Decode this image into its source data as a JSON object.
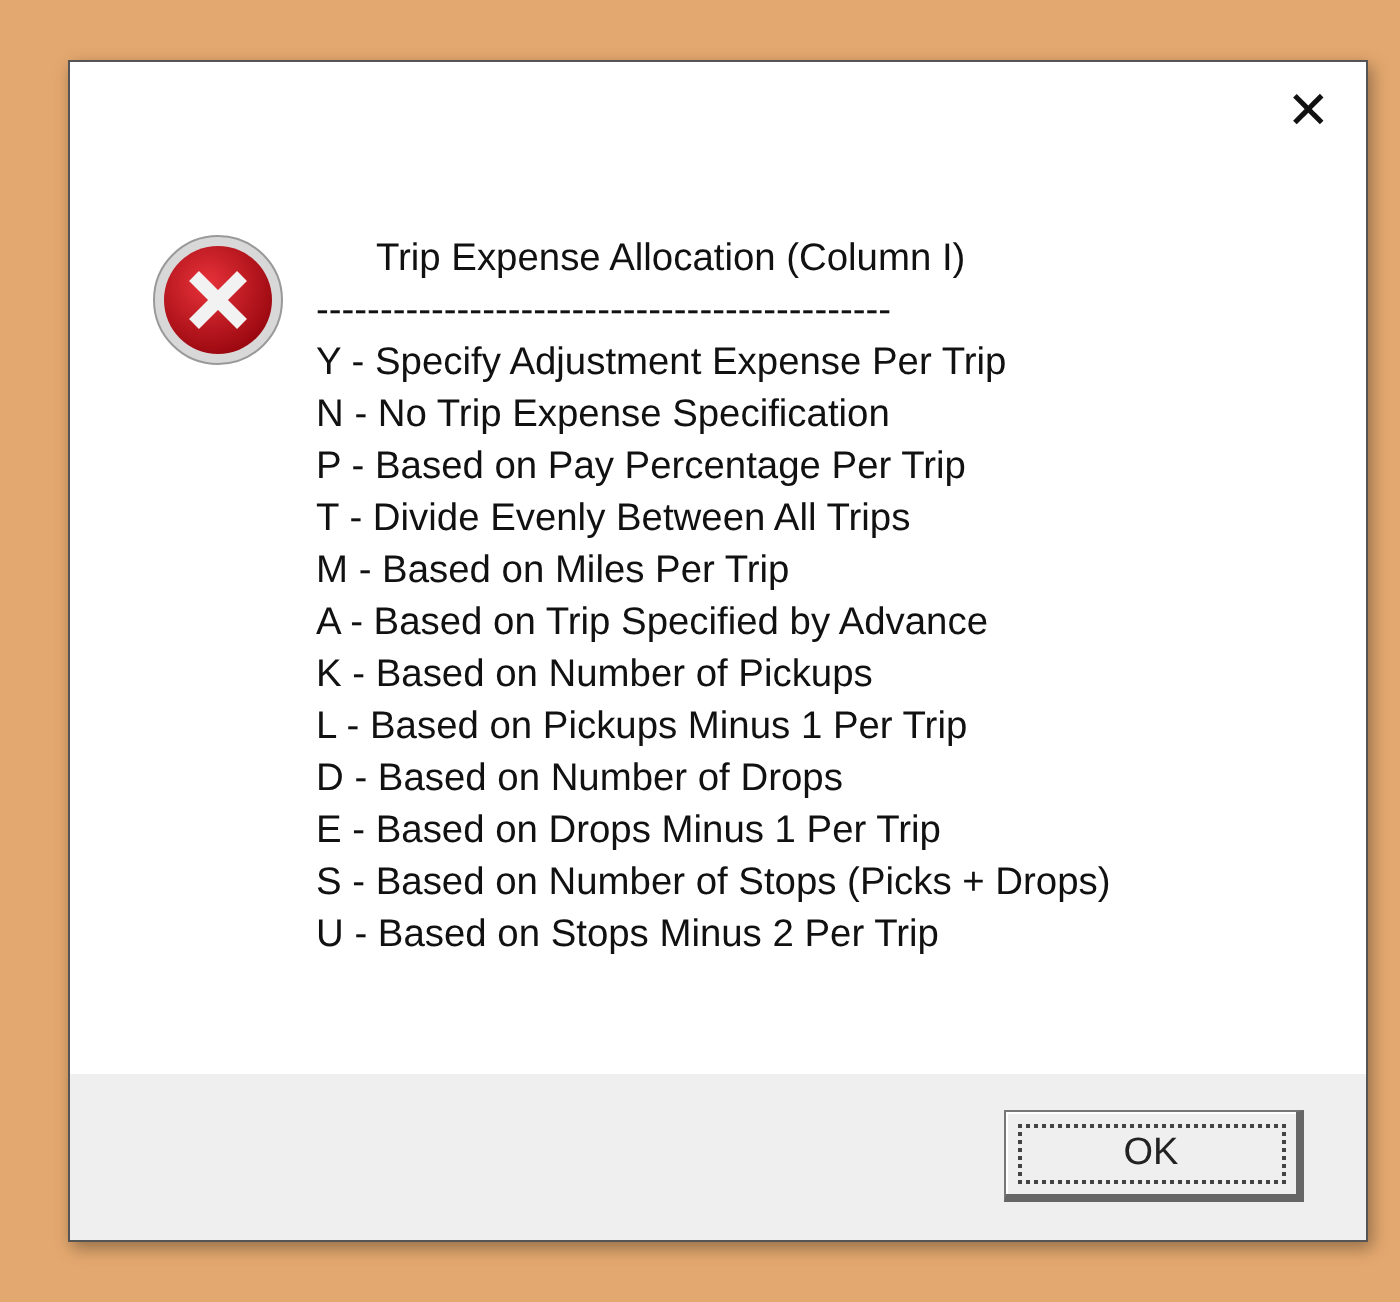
{
  "dialog": {
    "close": "✕",
    "title": "Trip Expense Allocation (Column I)",
    "separator": "---------------------------------------------",
    "lines": [
      "Y - Specify Adjustment Expense Per Trip",
      "N - No Trip Expense Specification",
      "P - Based on Pay Percentage Per Trip",
      "T - Divide Evenly Between All Trips",
      "M - Based on Miles Per Trip",
      "A - Based on Trip Specified by Advance",
      "K - Based on Number of Pickups",
      "L - Based on Pickups Minus 1 Per Trip",
      "D - Based on Number of Drops",
      "E - Based on Drops Minus 1 Per Trip",
      "S - Based on Number of Stops (Picks + Drops)",
      "U - Based on Stops Minus 2 Per Trip"
    ],
    "buttons": [
      {
        "label": "OK",
        "focused": true
      }
    ]
  }
}
